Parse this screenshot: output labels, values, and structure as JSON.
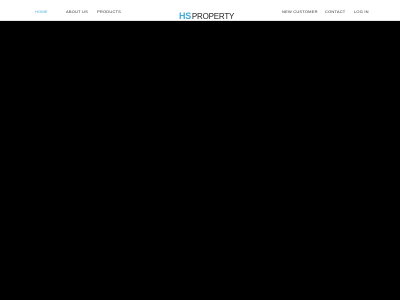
{
  "nav": {
    "left": [
      {
        "label": "HOME",
        "active": true
      },
      {
        "label": "ABOUT US",
        "active": false
      },
      {
        "label": "PRODUCTS",
        "active": false
      }
    ],
    "right": [
      {
        "label": "NEW CUSTOMER"
      },
      {
        "label": "CONTACT"
      },
      {
        "label": "LOG IN"
      }
    ]
  },
  "logo": {
    "mark": "HS",
    "word": "PROPERTY",
    "mark_color": "#3fa9d8",
    "word_color": "#222222"
  },
  "colors": {
    "active_link": "#3fa9d8",
    "link": "#333333",
    "hero_background": "#000000"
  }
}
